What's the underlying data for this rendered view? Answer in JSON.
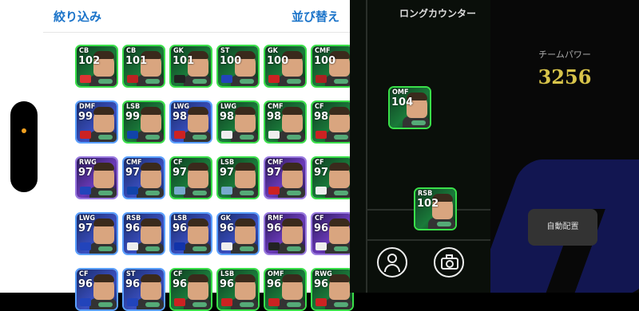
{
  "panel": {
    "filter_label": "絞り込み",
    "sort_label": "並び替え"
  },
  "cards": [
    {
      "pos": "CB",
      "rating": "102",
      "bg": "green",
      "flag": "#d33"
    },
    {
      "pos": "CB",
      "rating": "101",
      "bg": "green",
      "flag": "#b22"
    },
    {
      "pos": "GK",
      "rating": "101",
      "bg": "green",
      "flag": "#222"
    },
    {
      "pos": "ST",
      "rating": "100",
      "bg": "green",
      "flag": "#24b"
    },
    {
      "pos": "GK",
      "rating": "100",
      "bg": "green",
      "flag": "#c22"
    },
    {
      "pos": "CMF",
      "rating": "100",
      "bg": "green",
      "flag": "#a22"
    },
    {
      "pos": "DMF",
      "rating": "99",
      "bg": "blue",
      "flag": "#c22"
    },
    {
      "pos": "LSB",
      "rating": "99",
      "bg": "green",
      "flag": "#14a"
    },
    {
      "pos": "LWG",
      "rating": "98",
      "bg": "blue",
      "flag": "#c22"
    },
    {
      "pos": "LWG",
      "rating": "98",
      "bg": "green",
      "flag": "#eee"
    },
    {
      "pos": "CMF",
      "rating": "98",
      "bg": "green",
      "flag": "#eee"
    },
    {
      "pos": "CF",
      "rating": "98",
      "bg": "green",
      "flag": "#c22"
    },
    {
      "pos": "RWG",
      "rating": "97",
      "bg": "purple",
      "flag": "#24b"
    },
    {
      "pos": "CMF",
      "rating": "97",
      "bg": "blue",
      "flag": "#14a"
    },
    {
      "pos": "CF",
      "rating": "97",
      "bg": "green",
      "flag": "#7ac"
    },
    {
      "pos": "LSB",
      "rating": "97",
      "bg": "green",
      "flag": "#7ac"
    },
    {
      "pos": "CMF",
      "rating": "97",
      "bg": "purple",
      "flag": "#c22"
    },
    {
      "pos": "CF",
      "rating": "97",
      "bg": "green",
      "flag": "#eee"
    },
    {
      "pos": "LWG",
      "rating": "97",
      "bg": "blue",
      "flag": "#24b"
    },
    {
      "pos": "RSB",
      "rating": "96",
      "bg": "blue",
      "flag": "#eee"
    },
    {
      "pos": "LSB",
      "rating": "96",
      "bg": "blue",
      "flag": "#13a"
    },
    {
      "pos": "GK",
      "rating": "96",
      "bg": "blue",
      "flag": "#eee"
    },
    {
      "pos": "RMF",
      "rating": "96",
      "bg": "purple",
      "flag": "#222"
    },
    {
      "pos": "CF",
      "rating": "96",
      "bg": "purple",
      "flag": "#eee"
    },
    {
      "pos": "CF",
      "rating": "96",
      "bg": "blue",
      "flag": "#24b"
    },
    {
      "pos": "ST",
      "rating": "96",
      "bg": "blue",
      "flag": "#24b"
    },
    {
      "pos": "CF",
      "rating": "96",
      "bg": "green",
      "flag": "#c22"
    },
    {
      "pos": "LSB",
      "rating": "96",
      "bg": "green",
      "flag": "#c22"
    },
    {
      "pos": "OMF",
      "rating": "96",
      "bg": "green",
      "flag": "#c22"
    },
    {
      "pos": "RWG",
      "rating": "96",
      "bg": "green",
      "flag": "#c22"
    }
  ],
  "pitch": {
    "title": "ロングカウンター",
    "cards": [
      {
        "pos": "OMF",
        "rating": "104",
        "bg": "green"
      },
      {
        "pos": "RSB",
        "rating": "102",
        "bg": "green"
      }
    ]
  },
  "right": {
    "team_power_label": "チームパワー",
    "team_power_value": "3256",
    "auto_assign_label": "自動配置"
  }
}
